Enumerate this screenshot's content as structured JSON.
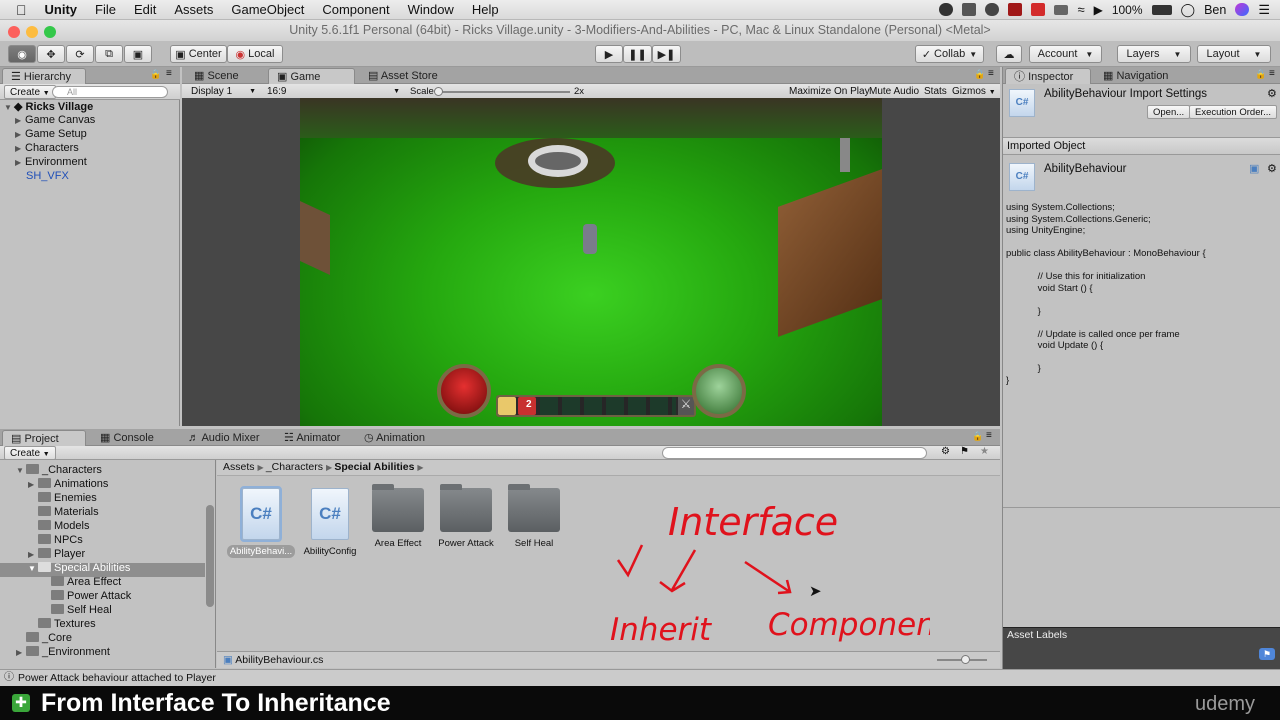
{
  "menubar": {
    "app": "Unity",
    "items": [
      "File",
      "Edit",
      "Assets",
      "GameObject",
      "Component",
      "Window",
      "Help"
    ],
    "battery": "100%",
    "user": "Ben"
  },
  "window_title": "Unity 5.6.1f1 Personal (64bit) - Ricks Village.unity - 3-Modifiers-And-Abilities - PC, Mac & Linux Standalone (Personal) <Metal>",
  "toolbar": {
    "pivot": "Center",
    "space": "Local",
    "collab": "Collab",
    "account": "Account",
    "layers": "Layers",
    "layout": "Layout"
  },
  "hierarchy": {
    "tab": "Hierarchy",
    "create": "Create",
    "search_placeholder": "All",
    "scene": "Ricks Village",
    "items": [
      "Game Canvas",
      "Game Setup",
      "Characters",
      "Environment",
      "SH_VFX"
    ]
  },
  "center_tabs": [
    "Scene",
    "Game",
    "Asset Store"
  ],
  "game_toolbar": {
    "display": "Display 1",
    "aspect": "16:9",
    "scale_label": "Scale",
    "scale_value": "2x",
    "maximize": "Maximize On Play",
    "mute": "Mute Audio",
    "stats": "Stats",
    "gizmos": "Gizmos"
  },
  "hud": {
    "ability_count": "2"
  },
  "bottom_tabs": [
    "Project",
    "Console",
    "Audio Mixer",
    "Animator",
    "Animation"
  ],
  "project": {
    "create": "Create",
    "tree": [
      {
        "label": "_Characters",
        "depth": 1,
        "open": true
      },
      {
        "label": "Animations",
        "depth": 2,
        "arrow": true
      },
      {
        "label": "Enemies",
        "depth": 2
      },
      {
        "label": "Materials",
        "depth": 2
      },
      {
        "label": "Models",
        "depth": 2
      },
      {
        "label": "NPCs",
        "depth": 2
      },
      {
        "label": "Player",
        "depth": 2,
        "arrow": true
      },
      {
        "label": "Special Abilities",
        "depth": 2,
        "open": true,
        "selected": true
      },
      {
        "label": "Area Effect",
        "depth": 3
      },
      {
        "label": "Power Attack",
        "depth": 3
      },
      {
        "label": "Self Heal",
        "depth": 3
      },
      {
        "label": "Textures",
        "depth": 2
      },
      {
        "label": "_Core",
        "depth": 1
      },
      {
        "label": "_Environment",
        "depth": 1,
        "arrow": true
      }
    ],
    "breadcrumb": [
      "Assets",
      "_Characters",
      "Special Abilities"
    ],
    "assets": [
      {
        "label": "AbilityBehavi...",
        "kind": "cs"
      },
      {
        "label": "AbilityConfig",
        "kind": "cs"
      },
      {
        "label": "Area Effect",
        "kind": "folder"
      },
      {
        "label": "Power Attack",
        "kind": "folder"
      },
      {
        "label": "Self Heal",
        "kind": "folder"
      }
    ],
    "selected_file": "AbilityBehaviour.cs"
  },
  "annotation": {
    "title": "Interface",
    "left": "Inherit",
    "right": "Component"
  },
  "inspector": {
    "tabs": [
      "Inspector",
      "Navigation"
    ],
    "header": "AbilityBehaviour Import Settings",
    "open_btn": "Open...",
    "exec_btn": "Execution Order...",
    "section": "Imported Object",
    "object_name": "AbilityBehaviour",
    "code": "using System.Collections;\nusing System.Collections.Generic;\nusing UnityEngine;\n\npublic class AbilityBehaviour : MonoBehaviour {\n\n            // Use this for initialization\n            void Start () {\n\n            }\n\n            // Update is called once per frame\n            void Update () {\n\n            }\n}",
    "asset_labels": "Asset Labels"
  },
  "status": "Power Attack behaviour attached to Player",
  "banner": {
    "title": "From Interface To Inheritance",
    "brand": "udemy"
  }
}
